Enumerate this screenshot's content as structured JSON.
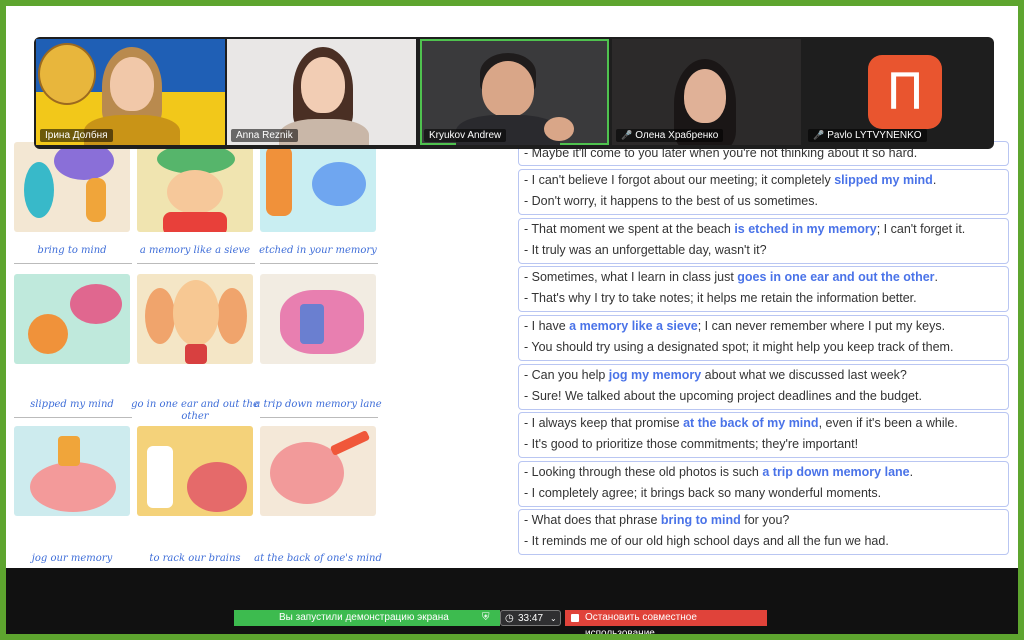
{
  "participants": [
    {
      "name": "Ірина Долбня",
      "muted": false
    },
    {
      "name": "Anna Reznik",
      "muted": false
    },
    {
      "name": "Kryukov Andrew",
      "muted": false,
      "active": true
    },
    {
      "name": "Олена Храбренко",
      "muted": true
    },
    {
      "name": "Pavlo LYTVYNENKO",
      "muted": true,
      "avatar_letter": "П"
    }
  ],
  "colors": {
    "accent": "#4a73e8",
    "border": "#b9c6f2",
    "active_speaker": "#4fc24f",
    "share_bar": "#3dbb4f",
    "stop_button": "#e0433a"
  },
  "idioms": [
    {
      "caption": "bring to mind"
    },
    {
      "caption": "a memory like a sieve"
    },
    {
      "caption": "etched in your memory"
    },
    {
      "caption": "slipped my mind"
    },
    {
      "caption": "go in one ear and out the other"
    },
    {
      "caption": "a trip down memory lane"
    },
    {
      "caption": "jog our memory"
    },
    {
      "caption": "to rack our brains"
    },
    {
      "caption": "at the back of one's mind"
    }
  ],
  "dialogs": [
    {
      "lines": [
        {
          "a": "- Maybe it'll come to you later when you're not thinking about it so hard.",
          "b": "",
          "c": ""
        }
      ]
    },
    {
      "lines": [
        {
          "a": "- I can't believe I forgot about our meeting; it completely ",
          "b": "slipped my mind",
          "c": "."
        },
        {
          "a": "- Don't worry, it happens to the best of us sometimes.",
          "b": "",
          "c": ""
        }
      ]
    },
    {
      "lines": [
        {
          "a": "- That moment we spent at the beach ",
          "b": "is etched in my memory",
          "c": "; I can't forget it."
        },
        {
          "a": "- It truly was an unforgettable day, wasn't it?",
          "b": "",
          "c": ""
        }
      ]
    },
    {
      "lines": [
        {
          "a": "- Sometimes, what I learn in class just ",
          "b": "goes in one ear and out the other",
          "c": "."
        },
        {
          "a": "- That's why I try to take notes; it helps me retain the information better.",
          "b": "",
          "c": ""
        }
      ]
    },
    {
      "lines": [
        {
          "a": "- I have ",
          "b": "a memory like a sieve",
          "c": "; I can never remember where I put my keys."
        },
        {
          "a": "- You should try using a designated spot; it might help you keep track of them.",
          "b": "",
          "c": ""
        }
      ]
    },
    {
      "lines": [
        {
          "a": "- Can you help ",
          "b": "jog my memory",
          "c": " about what we discussed last week?"
        },
        {
          "a": "- Sure! We talked about the upcoming project deadlines and the budget.",
          "b": "",
          "c": ""
        }
      ]
    },
    {
      "lines": [
        {
          "a": "- I always keep that promise ",
          "b": "at the back of my mind",
          "c": ", even if it's been a while."
        },
        {
          "a": "- It's good to prioritize those commitments; they're important!",
          "b": "",
          "c": ""
        }
      ]
    },
    {
      "lines": [
        {
          "a": "- Looking through these old photos is such ",
          "b": "a trip down memory lane",
          "c": "."
        },
        {
          "a": "- I completely agree; it brings back so many wonderful moments.",
          "b": "",
          "c": ""
        }
      ]
    },
    {
      "lines": [
        {
          "a": "- What does that phrase ",
          "b": "bring to mind",
          "c": " for you?"
        },
        {
          "a": "- It reminds me of our old high school days and all the fun we had.",
          "b": "",
          "c": ""
        }
      ]
    }
  ],
  "share_bar": {
    "status": "Вы запустили демонстрацию экрана",
    "timer": "33:47",
    "stop_label": "Остановить совместное использование"
  }
}
